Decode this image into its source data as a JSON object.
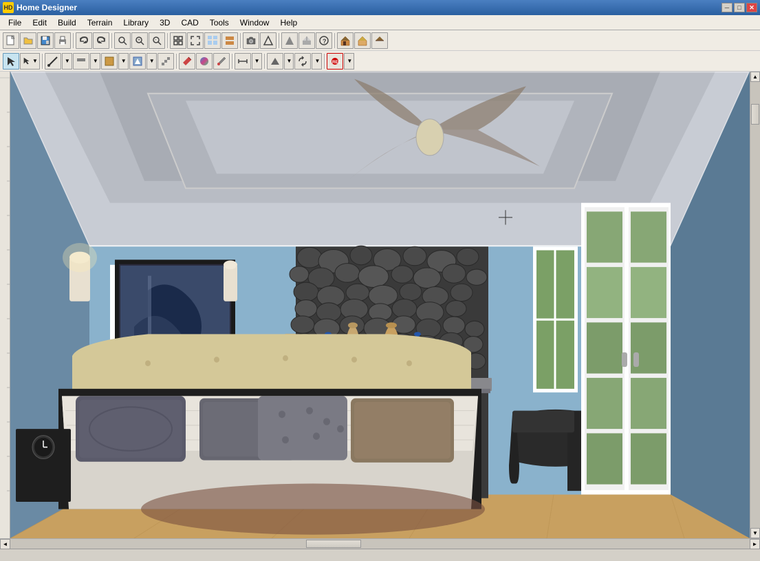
{
  "app": {
    "title": "Home Designer",
    "icon": "HD"
  },
  "titlebar": {
    "minimize_btn": "─",
    "maximize_btn": "□",
    "close_btn": "✕"
  },
  "menu": {
    "items": [
      {
        "id": "file",
        "label": "File"
      },
      {
        "id": "edit",
        "label": "Edit"
      },
      {
        "id": "build",
        "label": "Build"
      },
      {
        "id": "terrain",
        "label": "Terrain"
      },
      {
        "id": "library",
        "label": "Library"
      },
      {
        "id": "3d",
        "label": "3D"
      },
      {
        "id": "cad",
        "label": "CAD"
      },
      {
        "id": "tools",
        "label": "Tools"
      },
      {
        "id": "window",
        "label": "Window"
      },
      {
        "id": "help",
        "label": "Help"
      }
    ]
  },
  "toolbar1": {
    "buttons": [
      {
        "id": "new",
        "icon": "📄",
        "label": "New"
      },
      {
        "id": "open",
        "icon": "📂",
        "label": "Open"
      },
      {
        "id": "save",
        "icon": "💾",
        "label": "Save"
      },
      {
        "id": "print",
        "icon": "🖨",
        "label": "Print"
      },
      {
        "id": "undo",
        "icon": "↩",
        "label": "Undo"
      },
      {
        "id": "redo",
        "icon": "↪",
        "label": "Redo"
      },
      {
        "id": "zoom-out",
        "icon": "🔍",
        "label": "Zoom Out"
      },
      {
        "id": "zoom-in",
        "icon": "⊕",
        "label": "Zoom In"
      },
      {
        "id": "zoom-minus",
        "icon": "⊖",
        "label": "Zoom Minus"
      },
      {
        "id": "fit",
        "icon": "⊞",
        "label": "Fit to View"
      }
    ]
  },
  "statusbar": {
    "text": ""
  },
  "viewport": {
    "scene": "3D Bedroom Interior"
  }
}
